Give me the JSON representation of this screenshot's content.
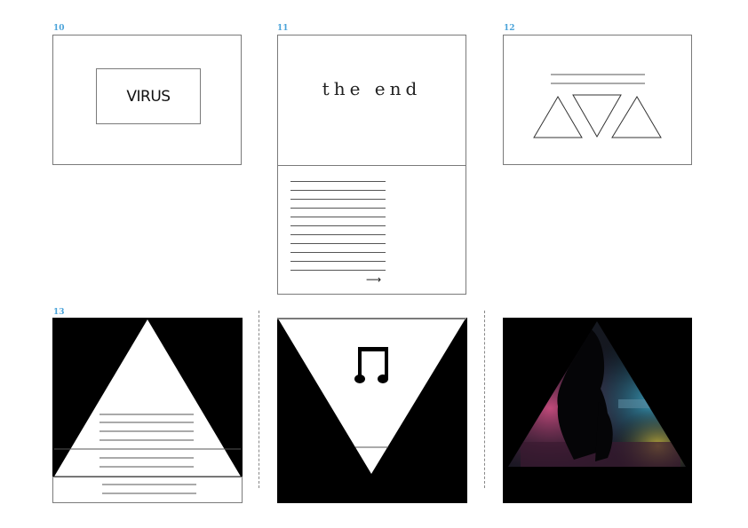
{
  "panel_numbers": {
    "p10": "10",
    "p11": "11",
    "p12": "12",
    "p13": "13"
  },
  "panel10": {
    "title": "VIRUS"
  },
  "panel11": {
    "title": "the end",
    "arrow_symbol": "⟶"
  },
  "icons": {
    "music_note": "music-note-icon"
  },
  "colors": {
    "panel_number": "#4aa3d9",
    "border": "#7a7a7a",
    "black": "#000000",
    "white": "#ffffff"
  }
}
